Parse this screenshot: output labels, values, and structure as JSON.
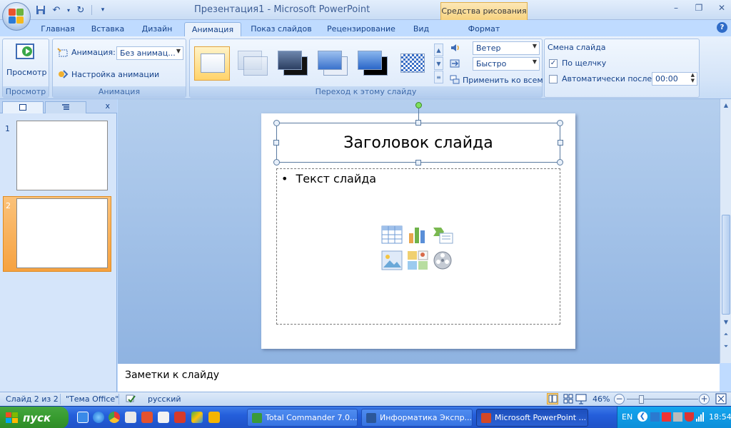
{
  "window": {
    "title": "Презентация1 - Microsoft PowerPoint",
    "contextual_tab_header": "Средства рисования"
  },
  "tabs": [
    {
      "label": "Главная"
    },
    {
      "label": "Вставка"
    },
    {
      "label": "Дизайн"
    },
    {
      "label": "Анимация",
      "active": true
    },
    {
      "label": "Показ слайдов"
    },
    {
      "label": "Рецензирование"
    },
    {
      "label": "Вид"
    },
    {
      "label": "Формат"
    }
  ],
  "ribbon": {
    "preview_group": {
      "button_label": "Просмотр",
      "group_label": "Просмотр"
    },
    "animation_group": {
      "animation_label": "Анимация:",
      "animation_value": "Без анимац...",
      "custom_animation_label": "Настройка анимации",
      "group_label": "Анимация"
    },
    "transition_group": {
      "sound_value": "Ветер",
      "speed_value": "Быстро",
      "apply_all_label": "Применить ко всем",
      "group_label": "Переход к этому слайду"
    },
    "advance_group": {
      "title": "Смена слайда",
      "on_click_label": "По щелчку",
      "on_click_checked": true,
      "auto_after_label": "Автоматически после:",
      "auto_after_checked": false,
      "auto_after_value": "00:00"
    }
  },
  "slides_panel": {
    "close_label": "x",
    "slides": [
      {
        "number": "1"
      },
      {
        "number": "2",
        "selected": true
      }
    ]
  },
  "slide": {
    "title": "Заголовок слайда",
    "bullet": "•",
    "body_text": "Текст слайда"
  },
  "notes": {
    "placeholder": "Заметки к слайду"
  },
  "statusbar": {
    "slide_count": "Слайд 2 из 2",
    "theme": "\"Тема Office\"",
    "language": "русский",
    "zoom": "46%",
    "zoom_minus": "−",
    "zoom_plus": "+"
  },
  "taskbar": {
    "start_label": "пуск",
    "tasks": [
      {
        "label": "Total Commander 7.0..."
      },
      {
        "label": "Информатика Экспр..."
      },
      {
        "label": "Microsoft PowerPoint ...",
        "active": true
      }
    ],
    "language": "EN",
    "clock": "18:54"
  },
  "colors": {
    "ribbon_accent": "#15428b",
    "selected_slide": "#f6a240",
    "taskbar": "#245edb",
    "start_button": "#379b2f"
  }
}
